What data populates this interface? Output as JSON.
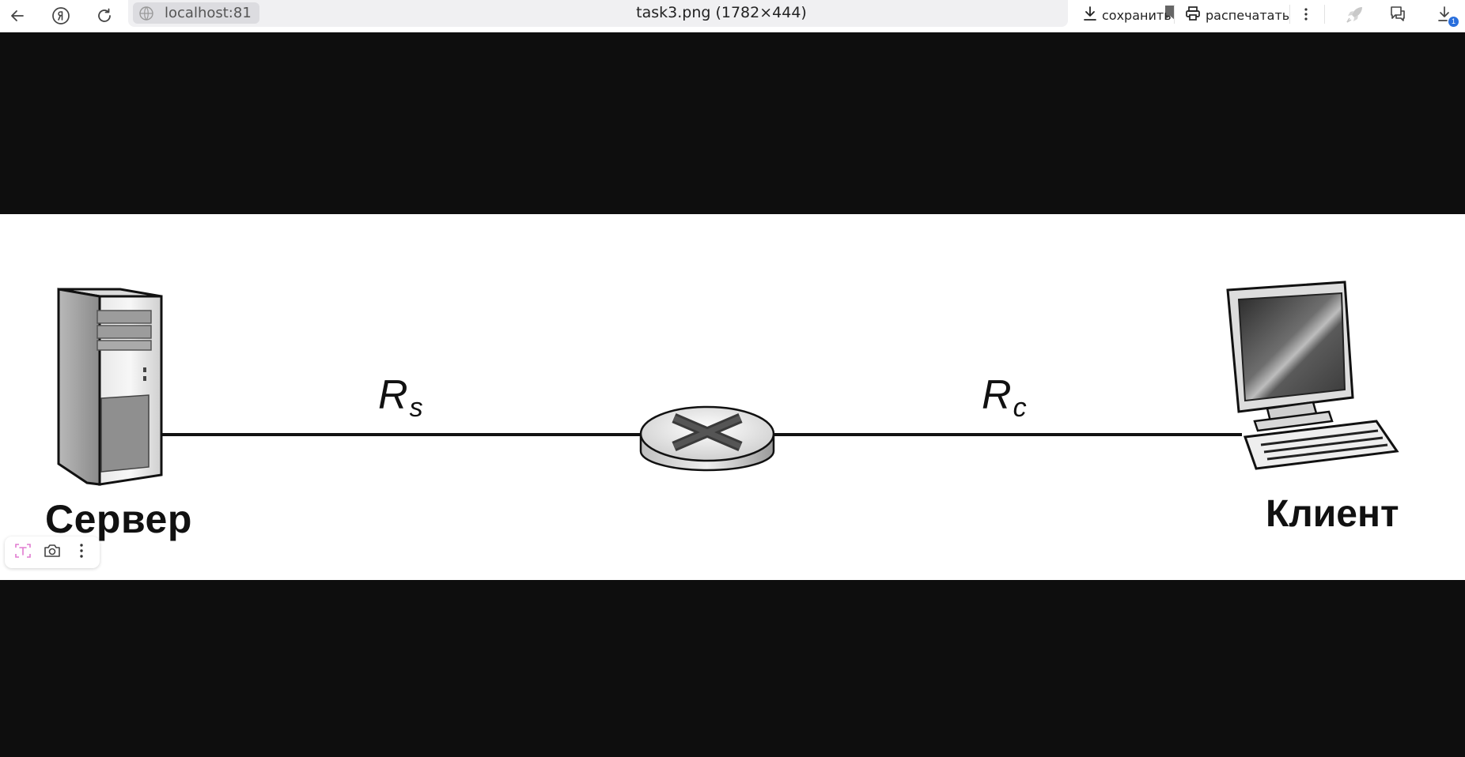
{
  "browser": {
    "address": "localhost:81",
    "tab_title": "task3.png (1782×444)",
    "save_label": "сохранить",
    "print_label": "распечатать",
    "downloads_count": "1"
  },
  "diagram": {
    "server_label": "Сервер",
    "client_label": "Клиент",
    "link_server": {
      "symbol": "R",
      "subscript": "s"
    },
    "link_client": {
      "symbol": "R",
      "subscript": "c"
    }
  },
  "icons": {
    "back": "arrow-left-icon",
    "yandex": "yandex-logo-icon",
    "reload": "reload-icon",
    "globe": "globe-icon",
    "bookmark": "bookmark-icon",
    "download": "download-icon",
    "print": "printer-icon",
    "more": "more-vertical-icon",
    "extension": "rocket-icon",
    "chat": "chat-icon",
    "downloads": "downloads-icon",
    "text_recognition": "text-scan-icon",
    "camera": "camera-icon"
  },
  "colors": {
    "viewer_bg": "#0e0e0e",
    "image_bg": "#ffffff",
    "badge": "#2a6fdc",
    "text_scan_accent": "#e07bd0"
  }
}
